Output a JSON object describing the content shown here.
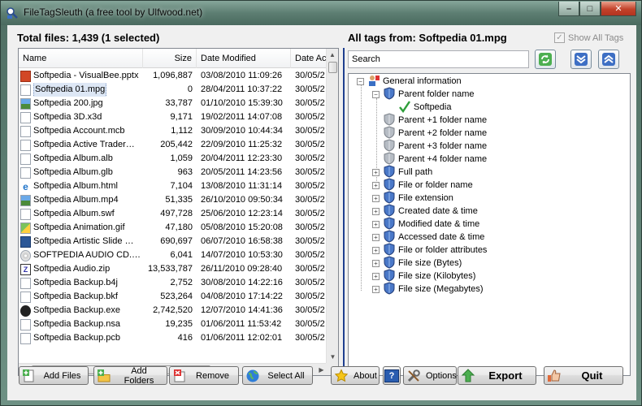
{
  "window": {
    "title": "FileTagSleuth (a free tool by Ulfwood.net)",
    "controls": {
      "minimize": "–",
      "maximize": "□",
      "close": "✕"
    }
  },
  "left_panel": {
    "total_files": "Total files: 1,439 (1 selected)",
    "columns": [
      "Name",
      "Size",
      "Date Modified",
      "Date Ac"
    ],
    "rows": [
      {
        "name": "Softpedia - VisualBee.pptx",
        "size": "1,096,887",
        "modified": "03/08/2010 11:09:26",
        "accessed": "30/05/2",
        "icon": "ppt"
      },
      {
        "name": "Softpedia 01.mpg",
        "size": "0",
        "modified": "28/04/2011 10:37:22",
        "accessed": "30/05/2",
        "icon": "blank",
        "selected": true
      },
      {
        "name": "Softpedia 200.jpg",
        "size": "33,787",
        "modified": "01/10/2010 15:39:30",
        "accessed": "30/05/2",
        "icon": "img"
      },
      {
        "name": "Softpedia 3D.x3d",
        "size": "9,171",
        "modified": "19/02/2011 14:07:08",
        "accessed": "30/05/2",
        "icon": "blank"
      },
      {
        "name": "Softpedia Account.mcb",
        "size": "1,112",
        "modified": "30/09/2010 10:44:34",
        "accessed": "30/05/2",
        "icon": "blank"
      },
      {
        "name": "Softpedia Active Trader…",
        "size": "205,442",
        "modified": "22/09/2010 11:25:32",
        "accessed": "30/05/2",
        "icon": "blank"
      },
      {
        "name": "Softpedia Album.alb",
        "size": "1,059",
        "modified": "20/04/2011 12:23:30",
        "accessed": "30/05/2",
        "icon": "blank"
      },
      {
        "name": "Softpedia Album.glb",
        "size": "963",
        "modified": "20/05/2011 14:23:56",
        "accessed": "30/05/2",
        "icon": "blank"
      },
      {
        "name": "Softpedia Album.html",
        "size": "7,104",
        "modified": "13/08/2010 11:31:14",
        "accessed": "30/05/2",
        "icon": "ie"
      },
      {
        "name": "Softpedia Album.mp4",
        "size": "51,335",
        "modified": "26/10/2010 09:50:34",
        "accessed": "30/05/2",
        "icon": "img"
      },
      {
        "name": "Softpedia Album.swf",
        "size": "497,728",
        "modified": "25/06/2010 12:23:14",
        "accessed": "30/05/2",
        "icon": "blank"
      },
      {
        "name": "Softpedia Animation.gif",
        "size": "47,180",
        "modified": "05/08/2010 15:20:08",
        "accessed": "30/05/2",
        "icon": "gif"
      },
      {
        "name": "Softpedia Artistic Slide …",
        "size": "690,697",
        "modified": "06/07/2010 16:58:38",
        "accessed": "30/05/2",
        "icon": "word"
      },
      {
        "name": "SOFTPEDIA AUDIO CD.…",
        "size": "6,041",
        "modified": "14/07/2010 10:53:30",
        "accessed": "30/05/2",
        "icon": "cd"
      },
      {
        "name": "Softpedia Audio.zip",
        "size": "13,533,787",
        "modified": "26/11/2010 09:28:40",
        "accessed": "30/05/2",
        "icon": "zip"
      },
      {
        "name": "Softpedia Backup.b4j",
        "size": "2,752",
        "modified": "30/08/2010 14:22:16",
        "accessed": "30/05/2",
        "icon": "blank"
      },
      {
        "name": "Softpedia Backup.bkf",
        "size": "523,264",
        "modified": "04/08/2010 17:14:22",
        "accessed": "30/05/2",
        "icon": "blank"
      },
      {
        "name": "Softpedia Backup.exe",
        "size": "2,742,520",
        "modified": "12/07/2010 14:41:36",
        "accessed": "30/05/2",
        "icon": "exe"
      },
      {
        "name": "Softpedia Backup.nsa",
        "size": "19,235",
        "modified": "01/06/2011 11:53:42",
        "accessed": "30/05/2",
        "icon": "blank"
      },
      {
        "name": "Softpedia Backup.pcb",
        "size": "416",
        "modified": "01/06/2011 12:02:01",
        "accessed": "30/05/2",
        "icon": "blank"
      }
    ]
  },
  "right_panel": {
    "header": "All tags from: Softpedia 01.mpg",
    "show_all_tags": "Show All Tags",
    "search_value": "Search",
    "tree": [
      {
        "label": "General information",
        "expander": "−",
        "icon": "user"
      },
      {
        "label": "Parent folder name",
        "expander": "−",
        "icon": "shield"
      },
      {
        "label": "Softpedia",
        "expander": "",
        "icon": "check"
      },
      {
        "label": "Parent +1 folder name",
        "expander": "",
        "icon": "shield-grey"
      },
      {
        "label": "Parent +2 folder name",
        "expander": "",
        "icon": "shield-grey"
      },
      {
        "label": "Parent +3 folder name",
        "expander": "",
        "icon": "shield-grey"
      },
      {
        "label": "Parent +4 folder name",
        "expander": "",
        "icon": "shield-grey"
      },
      {
        "label": "Full path",
        "expander": "+",
        "icon": "shield"
      },
      {
        "label": "File or folder name",
        "expander": "+",
        "icon": "shield"
      },
      {
        "label": "File extension",
        "expander": "+",
        "icon": "shield"
      },
      {
        "label": "Created date & time",
        "expander": "+",
        "icon": "shield"
      },
      {
        "label": "Modified date & time",
        "expander": "+",
        "icon": "shield"
      },
      {
        "label": "Accessed date & time",
        "expander": "+",
        "icon": "shield"
      },
      {
        "label": "File or folder attributes",
        "expander": "+",
        "icon": "shield"
      },
      {
        "label": "File size (Bytes)",
        "expander": "+",
        "icon": "shield"
      },
      {
        "label": "File size (Kilobytes)",
        "expander": "+",
        "icon": "shield"
      },
      {
        "label": "File size (Megabytes)",
        "expander": "+",
        "icon": "shield"
      }
    ]
  },
  "buttons": {
    "add_files": "Add Files",
    "add_folders": "Add Folders",
    "remove": "Remove",
    "select_all": "Select All",
    "about": "About",
    "help": "?",
    "options": "Options",
    "export": "Export",
    "quit": "Quit"
  },
  "colors": {
    "accent": "#1f3f8f",
    "selection": "#dde7f5"
  }
}
